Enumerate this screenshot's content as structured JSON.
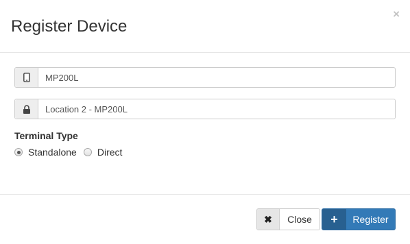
{
  "dialog": {
    "title": "Register Device",
    "close_icon": "×"
  },
  "fields": {
    "device_name": {
      "value": "MP200L",
      "icon": "mobile-phone-icon"
    },
    "location": {
      "value": "Location 2 - MP200L",
      "icon": "lock-icon"
    }
  },
  "terminal_type": {
    "label": "Terminal Type",
    "options": [
      {
        "label": "Standalone",
        "selected": true
      },
      {
        "label": "Direct",
        "selected": false
      }
    ]
  },
  "footer": {
    "close_label": "Close",
    "close_icon": "✖",
    "register_label": "Register",
    "register_icon": "+"
  },
  "colors": {
    "primary": "#337ab7",
    "primary_dark": "#286090"
  }
}
